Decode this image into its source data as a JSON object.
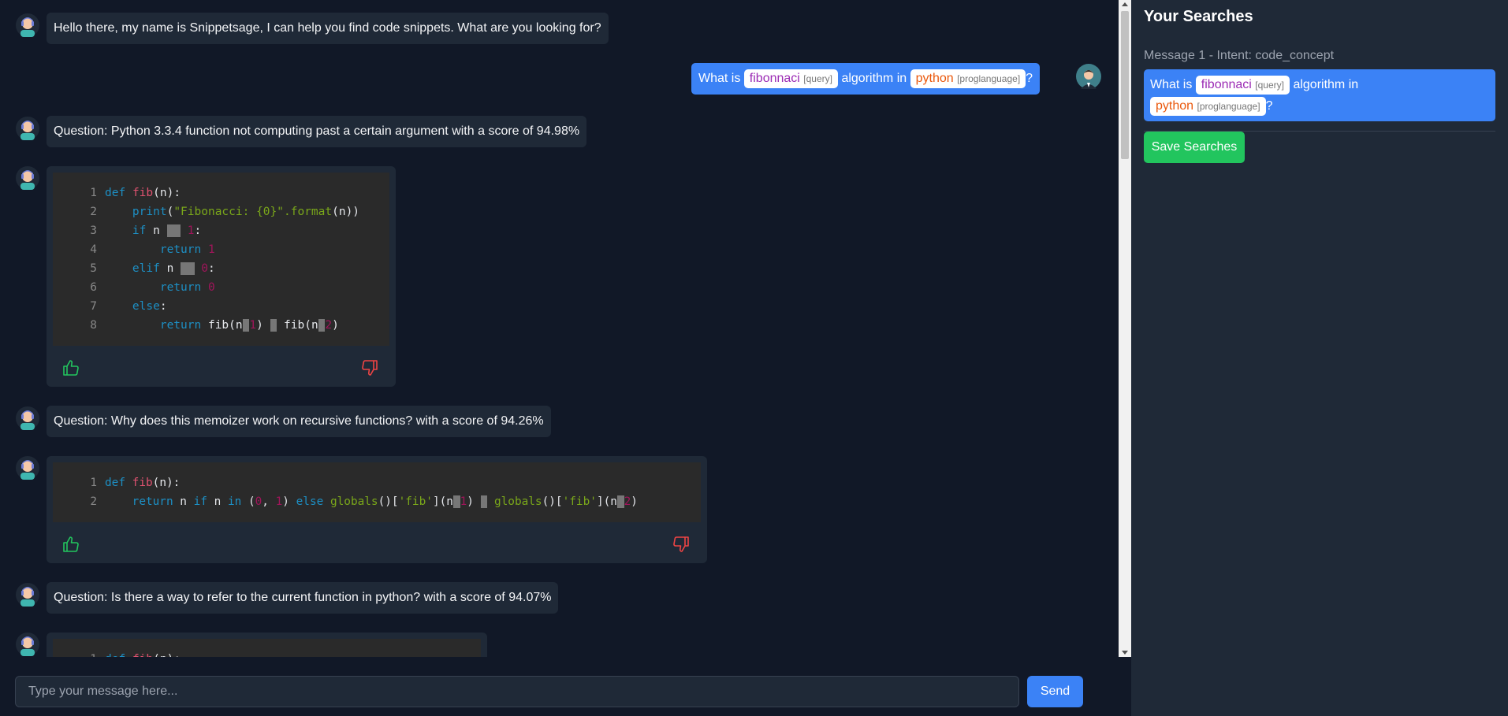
{
  "bot_greeting": "Hello there, my name is Snippetsage, I can help you find code snippets. What are you looking for?",
  "user_message": {
    "prefix": "What is",
    "query_word": "fibonnaci",
    "query_tag": "[query]",
    "middle": "algorithm in",
    "lang_word": "python",
    "lang_tag": "[proglanguage]",
    "suffix": "?"
  },
  "results": [
    {
      "question": "Question: Python 3.3.4 function not computing past a certain argument with a score of 94.98%",
      "code": [
        "def fib(n):",
        "    print(\"Fibonacci: {0}\".format(n))",
        "    if n == 1:",
        "        return 1",
        "    elif n == 0:",
        "        return 0",
        "    else:",
        "        return fib(n-1) + fib(n-2)"
      ]
    },
    {
      "question": "Question: Why does this memoizer work on recursive functions? with a score of 94.26%",
      "code": [
        "def fib(n):",
        "    return n if n in (0, 1) else globals()['fib'](n-1) + globals()['fib'](n-2)"
      ]
    },
    {
      "question": "Question: Is there a way to refer to the current function in python? with a score of 94.07%",
      "code": [
        "def fib(n):"
      ]
    }
  ],
  "input": {
    "placeholder": "Type your message here...",
    "send_label": "Send"
  },
  "sidebar": {
    "title": "Your Searches",
    "entry_label": "Message 1 - Intent: code_concept",
    "save_label": "Save Searches"
  },
  "colors": {
    "background": "#111827",
    "bubble": "#1f2937",
    "user_bubble": "#3b82f6",
    "save_button": "#22c55e",
    "thumbs_up": "#22c55e",
    "thumbs_down": "#ef4444"
  }
}
